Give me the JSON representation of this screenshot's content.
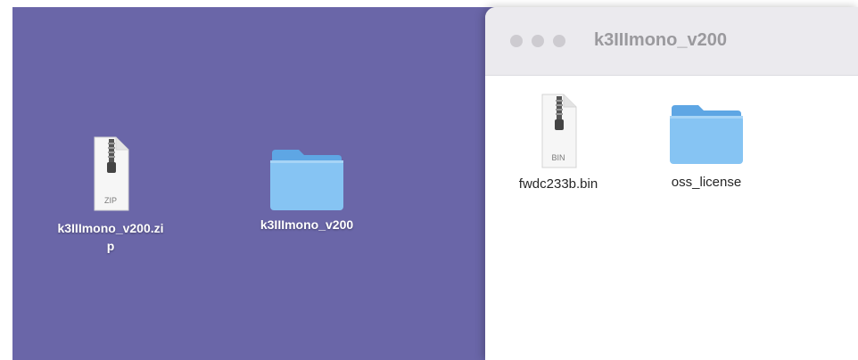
{
  "desktop": {
    "items": [
      {
        "label": "k3IIImono_v200.zi\np",
        "icon": "zip-file-icon",
        "badge": "ZIP"
      },
      {
        "label": "k3IIImono_v200",
        "icon": "folder-icon"
      }
    ]
  },
  "finder": {
    "title": "k3IIImono_v200",
    "items": [
      {
        "label": "fwdc233b.bin",
        "icon": "bin-file-icon",
        "badge": "BIN"
      },
      {
        "label": "oss_license",
        "icon": "folder-icon"
      }
    ]
  },
  "colors": {
    "desktop_bg": "#6a66a8",
    "folder": "#86c4f3",
    "titlebar": "#ebeaee"
  }
}
